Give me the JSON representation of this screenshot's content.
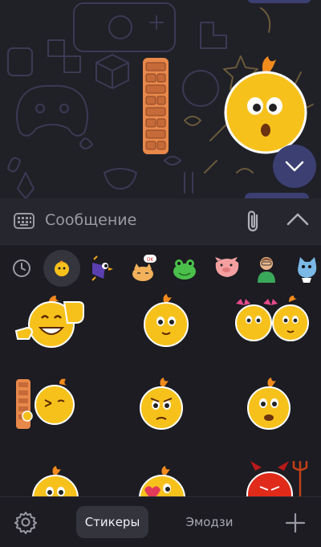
{
  "composer": {
    "placeholder": "Сообщение"
  },
  "sticker_sets": [
    {
      "name": "recent-icon"
    },
    {
      "name": "emoji-blob-set"
    },
    {
      "name": "purple-bird-set"
    },
    {
      "name": "cat-ok-set"
    },
    {
      "name": "frog-set"
    },
    {
      "name": "pig-set"
    },
    {
      "name": "person-set"
    },
    {
      "name": "cat-cyan-set"
    }
  ],
  "bottom_bar": {
    "stickers_label": "Стикеры",
    "emoji_label": "Эмодзи"
  },
  "colors": {
    "accent": "#3b3f72",
    "blob": "#f7c11c",
    "brick": "#c97a4a"
  }
}
